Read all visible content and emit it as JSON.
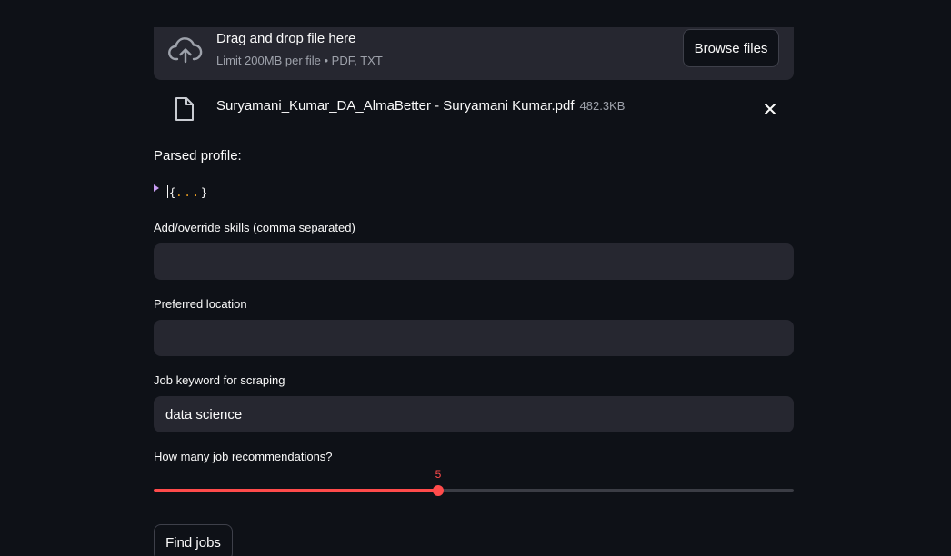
{
  "uploader": {
    "title": "Drag and drop file here",
    "subtitle": "Limit 200MB per file • PDF, TXT",
    "browse_label": "Browse files",
    "upload_icon": "cloud-upload-icon"
  },
  "uploaded_file": {
    "name": "Suryamani_Kumar_DA_AlmaBetter - Suryamani Kumar.pdf",
    "size": "482.3KB",
    "file_icon": "file-icon",
    "remove_icon": "close-icon"
  },
  "parsed_profile": {
    "label": "Parsed profile:",
    "open_brace": "{",
    "dots": "...",
    "close_brace": "}",
    "expanded": false
  },
  "fields": {
    "skills": {
      "label": "Add/override skills (comma separated)",
      "value": ""
    },
    "location": {
      "label": "Preferred location",
      "value": ""
    },
    "keyword": {
      "label": "Job keyword for scraping",
      "value": "data science"
    }
  },
  "slider": {
    "label": "How many job recommendations?",
    "value": 5,
    "min": 1,
    "max": 10
  },
  "find_button": {
    "label": "Find jobs"
  },
  "colors": {
    "background": "#0e1117",
    "surface": "#262730",
    "accent": "#ff4b4b",
    "muted_text": "#9ea2ab"
  }
}
